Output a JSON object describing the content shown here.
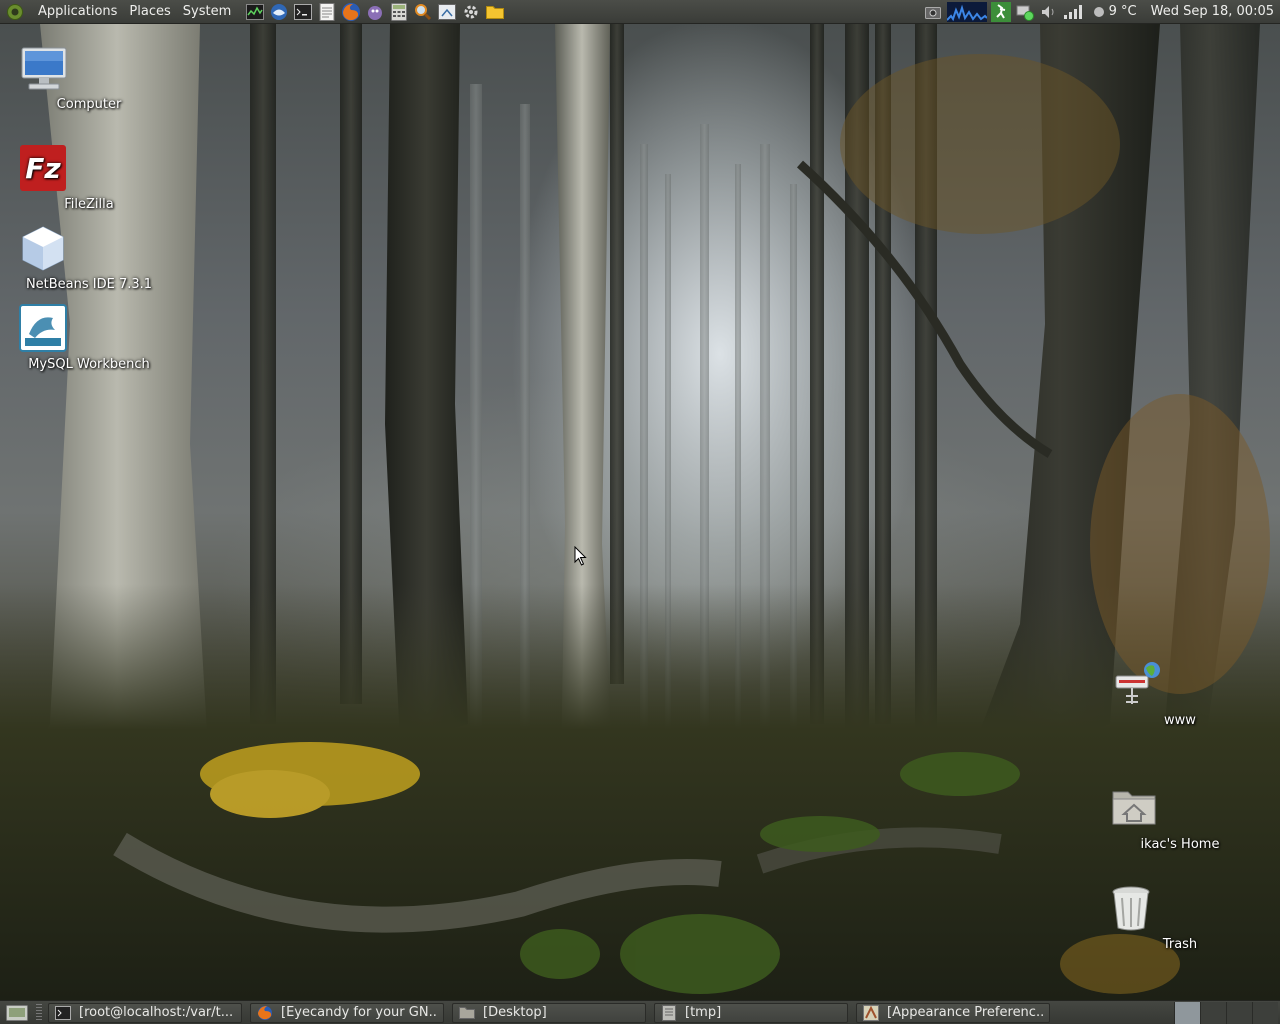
{
  "top_panel": {
    "menus": [
      "Applications",
      "Places",
      "System"
    ],
    "launchers": [
      {
        "icon": "system-monitor-icon"
      },
      {
        "icon": "thunderbird-icon"
      },
      {
        "icon": "terminal-icon"
      },
      {
        "icon": "text-editor-icon"
      },
      {
        "icon": "firefox-icon"
      },
      {
        "icon": "pidgin-icon"
      },
      {
        "icon": "calculator-icon"
      },
      {
        "icon": "search-icon"
      },
      {
        "icon": "screenshot-icon"
      },
      {
        "icon": "settings-icon"
      },
      {
        "icon": "folder-icon"
      }
    ],
    "tray": {
      "weather_temp": "9 °C",
      "clock": "Wed Sep 18, 00:05"
    }
  },
  "desktop_icons": [
    {
      "label": "Computer",
      "icon": "computer-icon"
    },
    {
      "label": "FileZilla",
      "icon": "filezilla-icon"
    },
    {
      "label": "NetBeans IDE 7.3.1",
      "icon": "netbeans-icon"
    },
    {
      "label": "MySQL Workbench",
      "icon": "mysql-workbench-icon"
    },
    {
      "label": "www",
      "icon": "network-share-icon"
    },
    {
      "label": "ikac's Home",
      "icon": "home-folder-icon"
    },
    {
      "label": "Trash",
      "icon": "trash-icon"
    }
  ],
  "taskbar": {
    "tasks": [
      {
        "label": "[root@localhost:/var/t...",
        "icon": "terminal-icon"
      },
      {
        "label": "[Eyecandy for your GN...",
        "icon": "firefox-icon"
      },
      {
        "label": "[Desktop]",
        "icon": "folder-icon"
      },
      {
        "label": "[tmp]",
        "icon": "text-editor-icon"
      },
      {
        "label": "[Appearance Preferenc...",
        "icon": "appearance-icon"
      }
    ],
    "workspace_count": 4,
    "active_workspace": 1
  },
  "colors": {
    "panel": "#3a3c38",
    "panel_text": "#eeeeec",
    "active_workspace": "#8f979c"
  }
}
